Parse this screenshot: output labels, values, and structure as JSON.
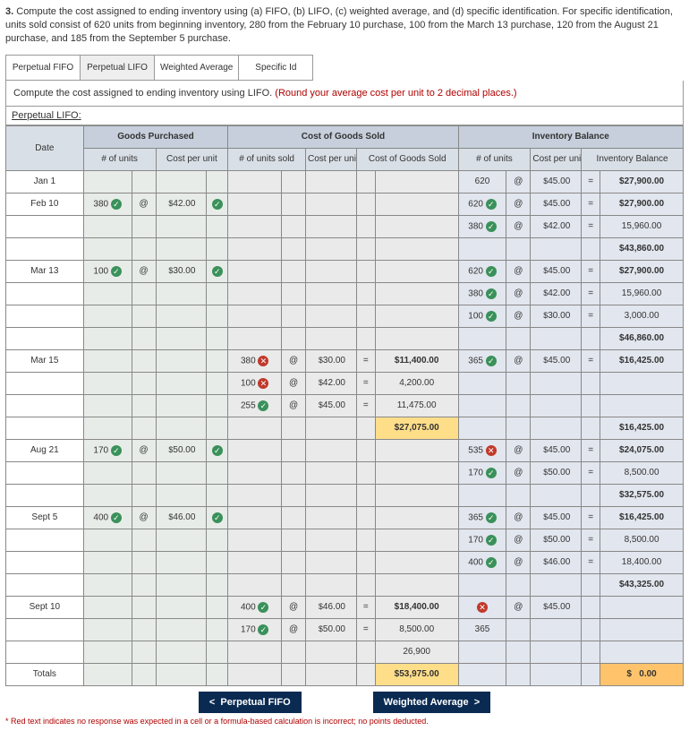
{
  "question": {
    "num": "3.",
    "text": "Compute the cost assigned to ending inventory using (a) FIFO, (b) LIFO, (c) weighted average, and (d) specific identification. For specific identification, units sold consist of 620 units from beginning inventory, 280 from the February 10 purchase, 100 from the March 13 purchase, 120 from the August 21 purchase, and 185 from the September 5 purchase."
  },
  "tabs": {
    "t1": "Perpetual FIFO",
    "t2": "Perpetual LIFO",
    "t3": "Weighted Average",
    "t4": "Specific Id"
  },
  "instruction": {
    "a": "Compute the cost assigned to ending inventory using LIFO. ",
    "b": "(Round your average cost per unit to 2 decimal places.)"
  },
  "title": "Perpetual LIFO:",
  "sections": {
    "gp": "Goods Purchased",
    "cogs": "Cost of Goods Sold",
    "ib": "Inventory Balance"
  },
  "col": {
    "date": "Date",
    "nu": "# of units",
    "cpu": "Cost per unit",
    "nus": "# of units sold",
    "cgs": "Cost of Goods Sold",
    "ibal": "Inventory Balance"
  },
  "d": {
    "jan1": "Jan 1",
    "feb10": "Feb 10",
    "mar13": "Mar 13",
    "mar15": "Mar 15",
    "aug21": "Aug 21",
    "sept5": "Sept 5",
    "sept10": "Sept 10",
    "totals": "Totals"
  },
  "sym": {
    "at": "@",
    "eq": "=",
    "dol": "$",
    "lt": "<",
    "gt": ">"
  },
  "v": {
    "u620": "620",
    "u380": "380",
    "u100": "100",
    "u170": "170",
    "u400": "400",
    "u255": "255",
    "u365": "365",
    "u535": "535",
    "c4500": "45.00",
    "c4200": "42.00",
    "c3000": "30.00",
    "c5000": "50.00",
    "c4600": "46.00",
    "m27900": "$27,900.00",
    "m15960": "15,960.00",
    "m43860": "$43,860.00",
    "m3000": "3,000.00",
    "m46860": "$46,860.00",
    "m11400": "$11,400.00",
    "m4200": "4,200.00",
    "m11475": "11,475.00",
    "m27075": "$27,075.00",
    "m16425": "$16,425.00",
    "m24075": "$24,075.00",
    "m8500": "8,500.00",
    "m32575": "$32,575.00",
    "m18400": "18,400.00",
    "m43325": "$43,325.00",
    "m18400d": "$18,400.00",
    "m26900": "26,900",
    "m53975": "$53,975.00",
    "m000": "0.00"
  },
  "nav": {
    "prev": "Perpetual FIFO",
    "next": "Weighted Average"
  },
  "footnote": "* Red text indicates no response was expected in a cell or a formula-based calculation is incorrect; no points deducted."
}
